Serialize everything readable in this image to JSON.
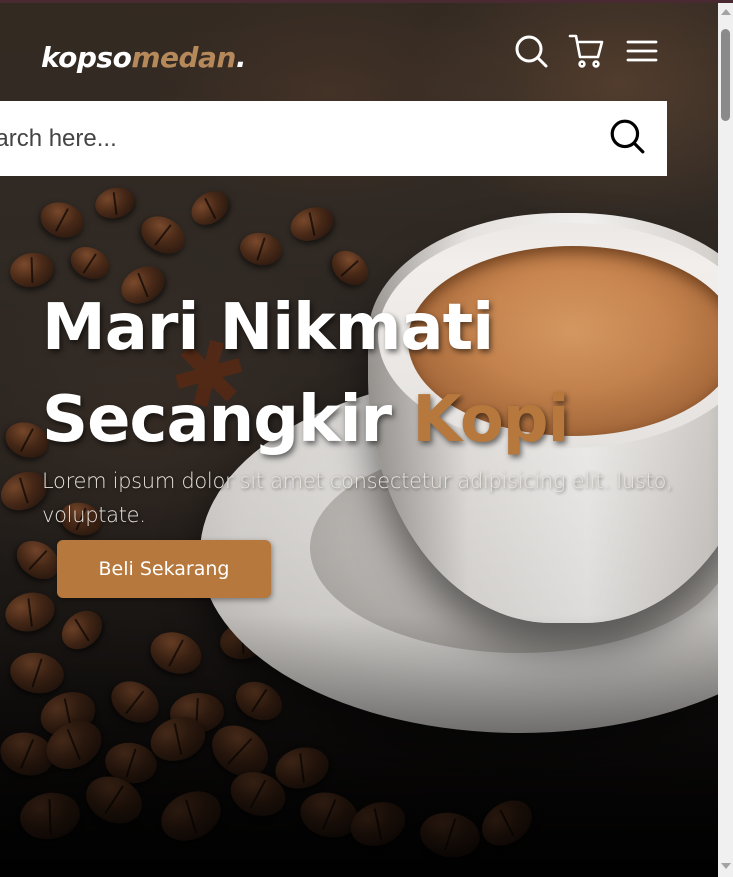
{
  "navbar": {
    "logo_main": "kopso",
    "logo_accent": "medan",
    "logo_dot": ".",
    "icons": [
      "search-icon",
      "shopping-cart-icon",
      "menu-icon"
    ]
  },
  "search": {
    "placeholder": "search here...",
    "icon": "search-icon"
  },
  "hero": {
    "headline_line1": "Mari Nikmati",
    "headline_line2_main": "Secangkir",
    "headline_line2_accent": "Kopi",
    "description": "Lorem ipsum dolor sit amet consectetur adipisicing elit. Iusto, voluptate.",
    "cta_label": "Beli Sekarang"
  },
  "colors": {
    "accent": "#b6783c",
    "logo_accent": "#b6895b",
    "text_light": "#ffffff"
  }
}
